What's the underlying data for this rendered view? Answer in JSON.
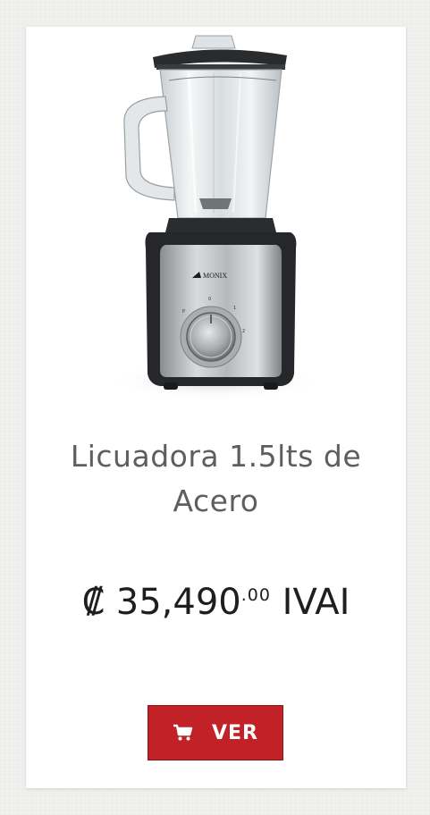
{
  "product": {
    "title": "Licuadora 1.5lts de Acero",
    "image_brand_text": "MONIX",
    "price": {
      "currency_symbol": "₡",
      "amount": "35,490",
      "cents": ".00",
      "tax_label": "IVAI"
    },
    "button": {
      "label": "VER",
      "icon": "shopping-cart-icon"
    }
  },
  "colors": {
    "button_bg": "#c12127",
    "title_text": "#5e5e5e",
    "price_text": "#1e1e1e",
    "page_bg": "#f0f0ef"
  }
}
